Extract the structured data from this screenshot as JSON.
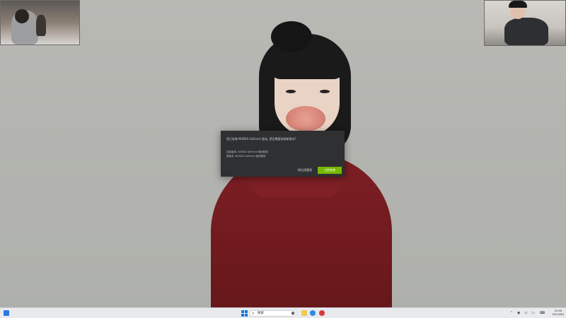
{
  "wallpaper": {
    "subject": "woman in red sweater holding a pink flower",
    "sweater_color": "#7d1f24",
    "flower_color": "#e29587"
  },
  "video_thumbnails": {
    "left": "video-left",
    "right": "video-right"
  },
  "dialog": {
    "message": "您已安装 NVIDIA GeForce 驱动, 是否需要安装新版本?",
    "line_1": "当前版本: NVIDIA GeForce 驱动程序",
    "line_2": "新版本: NVIDIA GeForce 驱动程序",
    "cancel_label": "稍后提醒我",
    "primary_label": "立即安装",
    "primary_color": "#76b900"
  },
  "taskbar": {
    "search_text": "搜索",
    "icons": [
      "widgets-icon",
      "windows-start-icon",
      "search-icon",
      "file-explorer-icon",
      "edge-browser-icon",
      "app-icon"
    ],
    "tray_icons": [
      "chevron-up-icon",
      "network-icon",
      "speaker-icon",
      "battery-icon",
      "keyboard-icon"
    ],
    "clock_time": "19:00",
    "clock_date": "2022/6/1"
  }
}
